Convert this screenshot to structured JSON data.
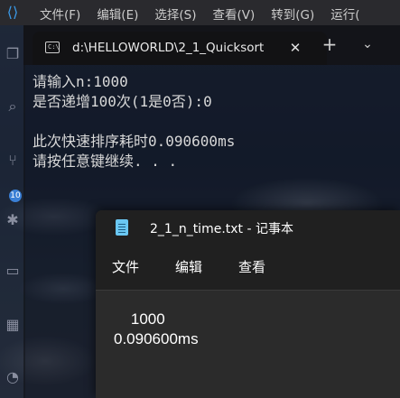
{
  "vscode": {
    "menu": [
      "文件(F)",
      "编辑(E)",
      "选择(S)",
      "查看(V)",
      "转到(G)",
      "运行("
    ],
    "badge": "10"
  },
  "terminal": {
    "tab_title": "d:\\HELLOWORLD\\2_1_Quicksort",
    "tab_icon": "C:\\",
    "close_glyph": "✕",
    "new_tab_glyph": "+",
    "dropdown_glyph": "⌄",
    "lines": [
      "请输入n:1000",
      "是否递增100次(1是0否):0",
      "",
      "此次快速排序耗时0.090600ms",
      "请按任意键继续. . ."
    ]
  },
  "notepad": {
    "title": "2_1_n_time.txt - 记事本",
    "menu": {
      "file": "文件",
      "edit": "编辑",
      "view": "查看"
    },
    "content": "    1000\n0.090600ms"
  },
  "colors": {
    "terminal_text": "#d8d8d8",
    "notepad_bg": "#2b2b2b",
    "notepad_bar": "#202020",
    "accent_blue": "#3a7fd5"
  }
}
